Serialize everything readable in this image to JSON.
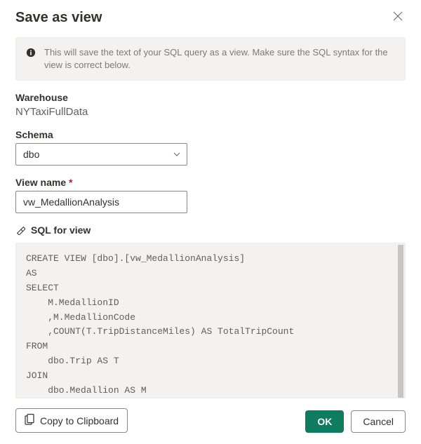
{
  "dialog": {
    "title": "Save as view",
    "info_text": "This will save the text of your SQL query as a view. Make sure the SQL syntax for the view is correct below."
  },
  "fields": {
    "warehouse_label": "Warehouse",
    "warehouse_value": "NYTaxiFullData",
    "schema_label": "Schema",
    "schema_value": "dbo",
    "viewname_label": "View name",
    "viewname_value": "vw_MedallionAnalysis",
    "viewname_required": "*"
  },
  "sql": {
    "header": "SQL for view",
    "code": "CREATE VIEW [dbo].[vw_MedallionAnalysis]\nAS\nSELECT\n    M.MedallionID\n    ,M.MedallionCode\n    ,COUNT(T.TripDistanceMiles) AS TotalTripCount\nFROM\n    dbo.Trip AS T\nJOIN\n    dbo.Medallion AS M"
  },
  "buttons": {
    "copy": "Copy to Clipboard",
    "ok": "OK",
    "cancel": "Cancel"
  }
}
